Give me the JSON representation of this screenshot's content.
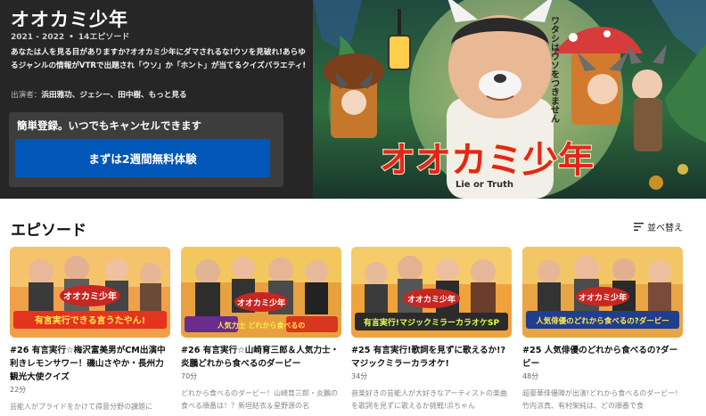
{
  "show": {
    "title": "オオカミ少年",
    "years": "2021 - 2022",
    "separator": "•",
    "episodes_count": "14エピソード",
    "description": "あなたは人を見る目がありますか?オオカミ少年にダマされるな!ウソを見破れ!あらゆるジャンルの情報がVTRで出題され「ウソ」か「ホント」が当てるクイズバラエティ!",
    "cast_label": "出演者：",
    "cast": "浜田雅功、ジェシー、田中樹、もっと見る"
  },
  "signup": {
    "text": "簡単登録。いつでもキャンセルできます",
    "button_label": "まずは2週間無料体験"
  },
  "key_art": {
    "logo_text": "オオカミ少年",
    "logo_sub": "Lie or Truth",
    "tagline": "ワタシはウソをつきません"
  },
  "episodes_section": {
    "title": "エピソード",
    "sort_label": "並べ替え"
  },
  "episodes": [
    {
      "title": "#26 有言実行☆梅沢富美男がCM出演中 利きレモンサワー！磯山さやか・長州力観光大使クイズ",
      "duration": "22分",
      "description": "芸能人がプライドをかけて得意分野の課題に",
      "thumb_banner": "有言実行できる言うたやん!"
    },
    {
      "title": "#26 有言実行☆山崎育三郎＆人気力士・炎鵬どれから食べるのダービー",
      "duration": "70分",
      "description": "どれから食べるのダービー！山崎育三郎・炎鵬の食べる順番は！？新垣結衣＆星野源の名",
      "thumb_banner": "人気力士 どれから食べるの"
    },
    {
      "title": "#25 有言実行!歌詞を見ずに歌えるか!?マジックミラーカラオケ!",
      "duration": "34分",
      "description": "音楽好きの芸能人が大好きなアーティストの楽曲を歌詞を見ずに歌えるか挑戦!浜ちゃん",
      "thumb_banner": "有言実行!マジックミラーカラオケSP"
    },
    {
      "title": "#25 人気俳優のどれから食べるの?ダービー",
      "duration": "48分",
      "description": "超豪華俳優陣が出演!どれから食べるのダービー!竹内涼真、有村架純は、どの順番で食",
      "thumb_banner": "人気俳優のどれから食べるの?ダービー"
    }
  ]
}
